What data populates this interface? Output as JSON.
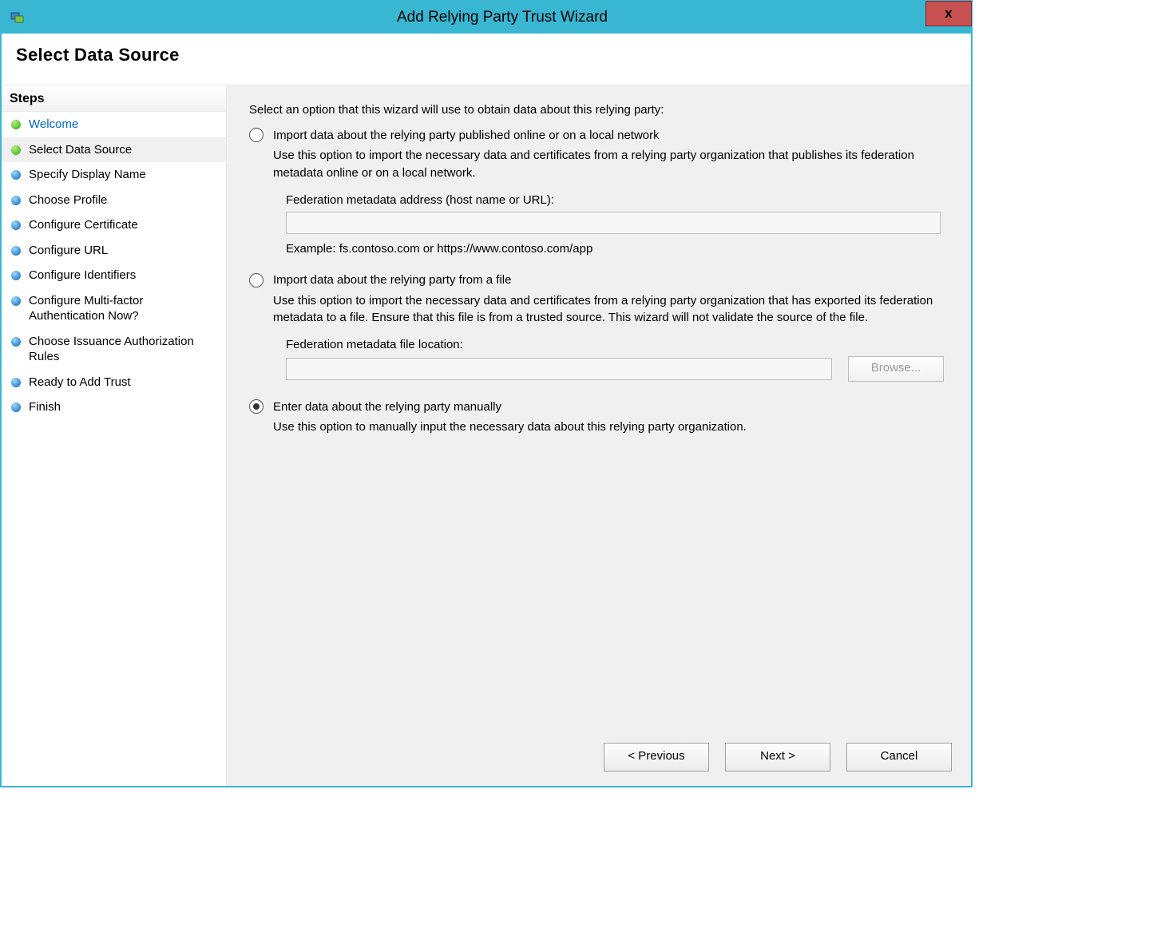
{
  "window": {
    "title": "Add Relying Party Trust Wizard",
    "page_title": "Select Data Source",
    "close_label": "x"
  },
  "sidebar": {
    "header": "Steps",
    "items": [
      {
        "label": "Welcome",
        "state": "done",
        "link": true
      },
      {
        "label": "Select Data Source",
        "state": "current",
        "link": false
      },
      {
        "label": "Specify Display Name",
        "state": "future",
        "link": false
      },
      {
        "label": "Choose Profile",
        "state": "future",
        "link": false
      },
      {
        "label": "Configure Certificate",
        "state": "future",
        "link": false
      },
      {
        "label": "Configure URL",
        "state": "future",
        "link": false
      },
      {
        "label": "Configure Identifiers",
        "state": "future",
        "link": false
      },
      {
        "label": "Configure Multi-factor Authentication Now?",
        "state": "future",
        "link": false
      },
      {
        "label": "Choose Issuance Authorization Rules",
        "state": "future",
        "link": false
      },
      {
        "label": "Ready to Add Trust",
        "state": "future",
        "link": false
      },
      {
        "label": "Finish",
        "state": "future",
        "link": false
      }
    ]
  },
  "main": {
    "prompt": "Select an option that this wizard will use to obtain data about this relying party:",
    "options": [
      {
        "id": "online",
        "selected": false,
        "title": "Import data about the relying party published online or on a local network",
        "desc": "Use this option to import the necessary data and certificates from a relying party organization that publishes its federation metadata online or on a local network.",
        "field_label": "Federation metadata address (host name or URL):",
        "field_value": "",
        "example": "Example: fs.contoso.com or https://www.contoso.com/app"
      },
      {
        "id": "file",
        "selected": false,
        "title": "Import data about the relying party from a file",
        "desc": "Use this option to import the necessary data and certificates from a relying party organization that has exported its federation metadata to a file. Ensure that this file is from a trusted source.  This wizard will not validate the source of the file.",
        "field_label": "Federation metadata file location:",
        "field_value": "",
        "browse_label": "Browse..."
      },
      {
        "id": "manual",
        "selected": true,
        "title": "Enter data about the relying party manually",
        "desc": "Use this option to manually input the necessary data about this relying party organization."
      }
    ]
  },
  "footer": {
    "previous": "< Previous",
    "next": "Next >",
    "cancel": "Cancel"
  }
}
